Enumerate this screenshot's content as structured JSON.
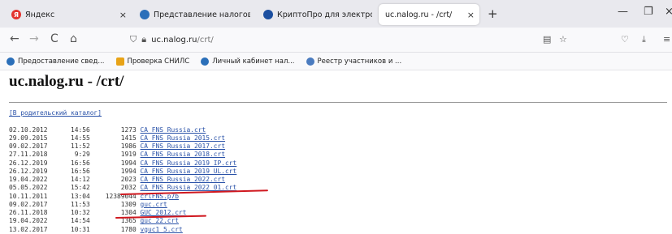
{
  "tabs": [
    {
      "title": "Яндекс",
      "icon": "yandex-icon"
    },
    {
      "title": "Представление налоговой и ( ×",
      "icon": "fns-icon"
    },
    {
      "title": "КриптоПро для электронной ( ×",
      "icon": "cryptopro-icon"
    },
    {
      "title": "uc.nalog.ru - /crt/",
      "icon": "page-icon",
      "active": true
    }
  ],
  "tab_close": "×",
  "new_tab": "+",
  "window_controls": {
    "minimize": "—",
    "restore": "❐",
    "close": "×"
  },
  "nav": {
    "back": "←",
    "forward": "→",
    "reload": "C",
    "home": "⌂",
    "url_host": "uc.nalog.ru",
    "url_path": "/crt/"
  },
  "bookmarks": [
    {
      "label": "Предоставление свед...",
      "color": "#2b6fb9"
    },
    {
      "label": "Проверка СНИЛС",
      "color": "#e8a317"
    },
    {
      "label": "Личный кабинет нал...",
      "color": "#2b6fb9"
    },
    {
      "label": "Реестр участников и ...",
      "color": "#4a7bbf"
    }
  ],
  "page": {
    "title": "uc.nalog.ru - /crt/",
    "parent_link": "[В родительский каталог]",
    "files": [
      {
        "date": "02.10.2012",
        "time": "14:56",
        "size": "1273",
        "name": "CA_FNS_Russia.crt"
      },
      {
        "date": "29.09.2015",
        "time": "14:55",
        "size": "1415",
        "name": "CA_FNS_Russia_2015.crt"
      },
      {
        "date": "09.02.2017",
        "time": "11:52",
        "size": "1986",
        "name": "CA_FNS_Russia_2017.crt"
      },
      {
        "date": "27.11.2018",
        "time": "9:29",
        "size": "1919",
        "name": "CA_FNS_Russia_2018.crt"
      },
      {
        "date": "26.12.2019",
        "time": "16:56",
        "size": "1994",
        "name": "CA_FNS_Russia_2019_IP.crt"
      },
      {
        "date": "26.12.2019",
        "time": "16:56",
        "size": "1994",
        "name": "CA_FNS_Russia_2019_UL.crt"
      },
      {
        "date": "19.04.2022",
        "time": "14:12",
        "size": "2023",
        "name": "CA_FNS_Russia_2022.crt"
      },
      {
        "date": "05.05.2022",
        "time": "15:42",
        "size": "2032",
        "name": "CA_FNS_Russia_2022_01.crt"
      },
      {
        "date": "10.11.2011",
        "time": "13:04",
        "size": "12389044",
        "name": "crlFNS.p7b"
      },
      {
        "date": "09.02.2017",
        "time": "11:53",
        "size": "1309",
        "name": "guc.crt"
      },
      {
        "date": "26.11.2018",
        "time": "10:32",
        "size": "1304",
        "name": "GUC_2012.crt"
      },
      {
        "date": "19.04.2022",
        "time": "14:54",
        "size": "1365",
        "name": "guc_22.crt"
      },
      {
        "date": "13.02.2017",
        "time": "10:31",
        "size": "1780",
        "name": "vguc1_5.crt"
      }
    ]
  },
  "annotation_color": "#d0181f"
}
